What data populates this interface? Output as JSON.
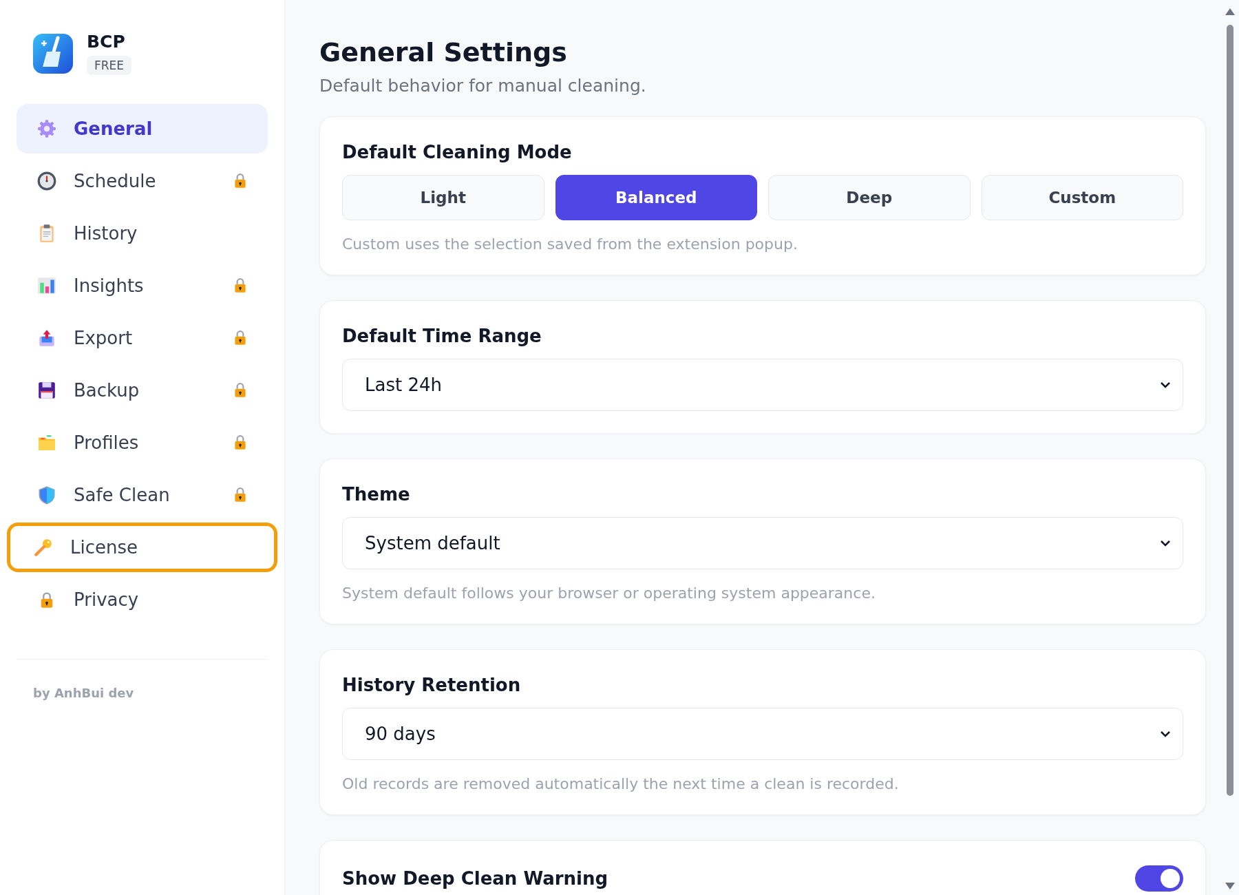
{
  "app": {
    "name": "BCP",
    "badge": "FREE"
  },
  "sidebar": {
    "items": [
      {
        "label": "General",
        "selected": true,
        "locked": false,
        "highlighted": false
      },
      {
        "label": "Schedule",
        "selected": false,
        "locked": true,
        "highlighted": false
      },
      {
        "label": "History",
        "selected": false,
        "locked": false,
        "highlighted": false
      },
      {
        "label": "Insights",
        "selected": false,
        "locked": true,
        "highlighted": false
      },
      {
        "label": "Export",
        "selected": false,
        "locked": true,
        "highlighted": false
      },
      {
        "label": "Backup",
        "selected": false,
        "locked": true,
        "highlighted": false
      },
      {
        "label": "Profiles",
        "selected": false,
        "locked": true,
        "highlighted": false
      },
      {
        "label": "Safe Clean",
        "selected": false,
        "locked": true,
        "highlighted": false
      },
      {
        "label": "License",
        "selected": false,
        "locked": false,
        "highlighted": true
      },
      {
        "label": "Privacy",
        "selected": false,
        "locked": false,
        "highlighted": false
      }
    ],
    "footer": "by AnhBui dev"
  },
  "page": {
    "title": "General Settings",
    "subtitle": "Default behavior for manual cleaning."
  },
  "sections": [
    {
      "kind": "segmented",
      "title": "Default Cleaning Mode",
      "options": [
        {
          "label": "Light",
          "selected": false
        },
        {
          "label": "Balanced",
          "selected": true
        },
        {
          "label": "Deep",
          "selected": false
        },
        {
          "label": "Custom",
          "selected": false
        }
      ],
      "hint": "Custom uses the selection saved from the extension popup."
    },
    {
      "kind": "select",
      "title": "Default Time Range",
      "value": "Last 24h"
    },
    {
      "kind": "select",
      "title": "Theme",
      "value": "System default",
      "hint": "System default follows your browser or operating system appearance."
    },
    {
      "kind": "select",
      "title": "History Retention",
      "value": "90 days",
      "hint": "Old records are removed automatically the next time a clean is recorded."
    },
    {
      "kind": "toggle",
      "title": "Show Deep Clean Warning",
      "on": true
    }
  ]
}
